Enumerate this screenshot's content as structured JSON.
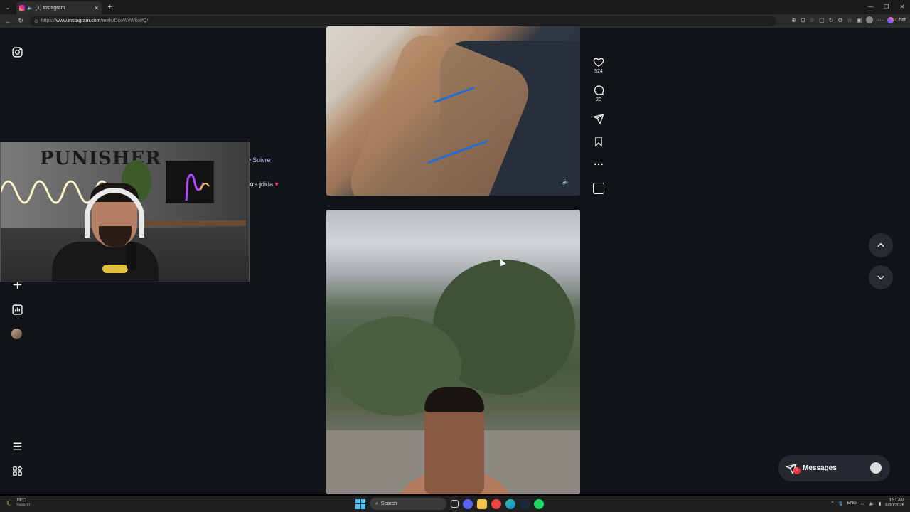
{
  "browser": {
    "tab_title": "(1) Instagram",
    "url_prefix": "https://",
    "url_domain": "www.instagram.com",
    "url_path": "/reels/DcoWvWkotfQ/",
    "chat_label": "Chat"
  },
  "reel_side": {
    "follow_label": "Suivre",
    "caption": "kra jdida"
  },
  "actions": {
    "likes": "524",
    "comments": "20"
  },
  "messages": {
    "label": "Messages",
    "badge": "1"
  },
  "webcam": {
    "poster_text": "PUNISHER"
  },
  "taskbar": {
    "temperature": "19°C",
    "weather": "Sereno",
    "search_placeholder": "Search",
    "language": "ENG",
    "time": "3:51 AM",
    "date": "8/30/2026"
  },
  "colors": {
    "page_bg": "#101418",
    "accent_follow": "#b9c2ff",
    "badge": "#ff3040"
  }
}
